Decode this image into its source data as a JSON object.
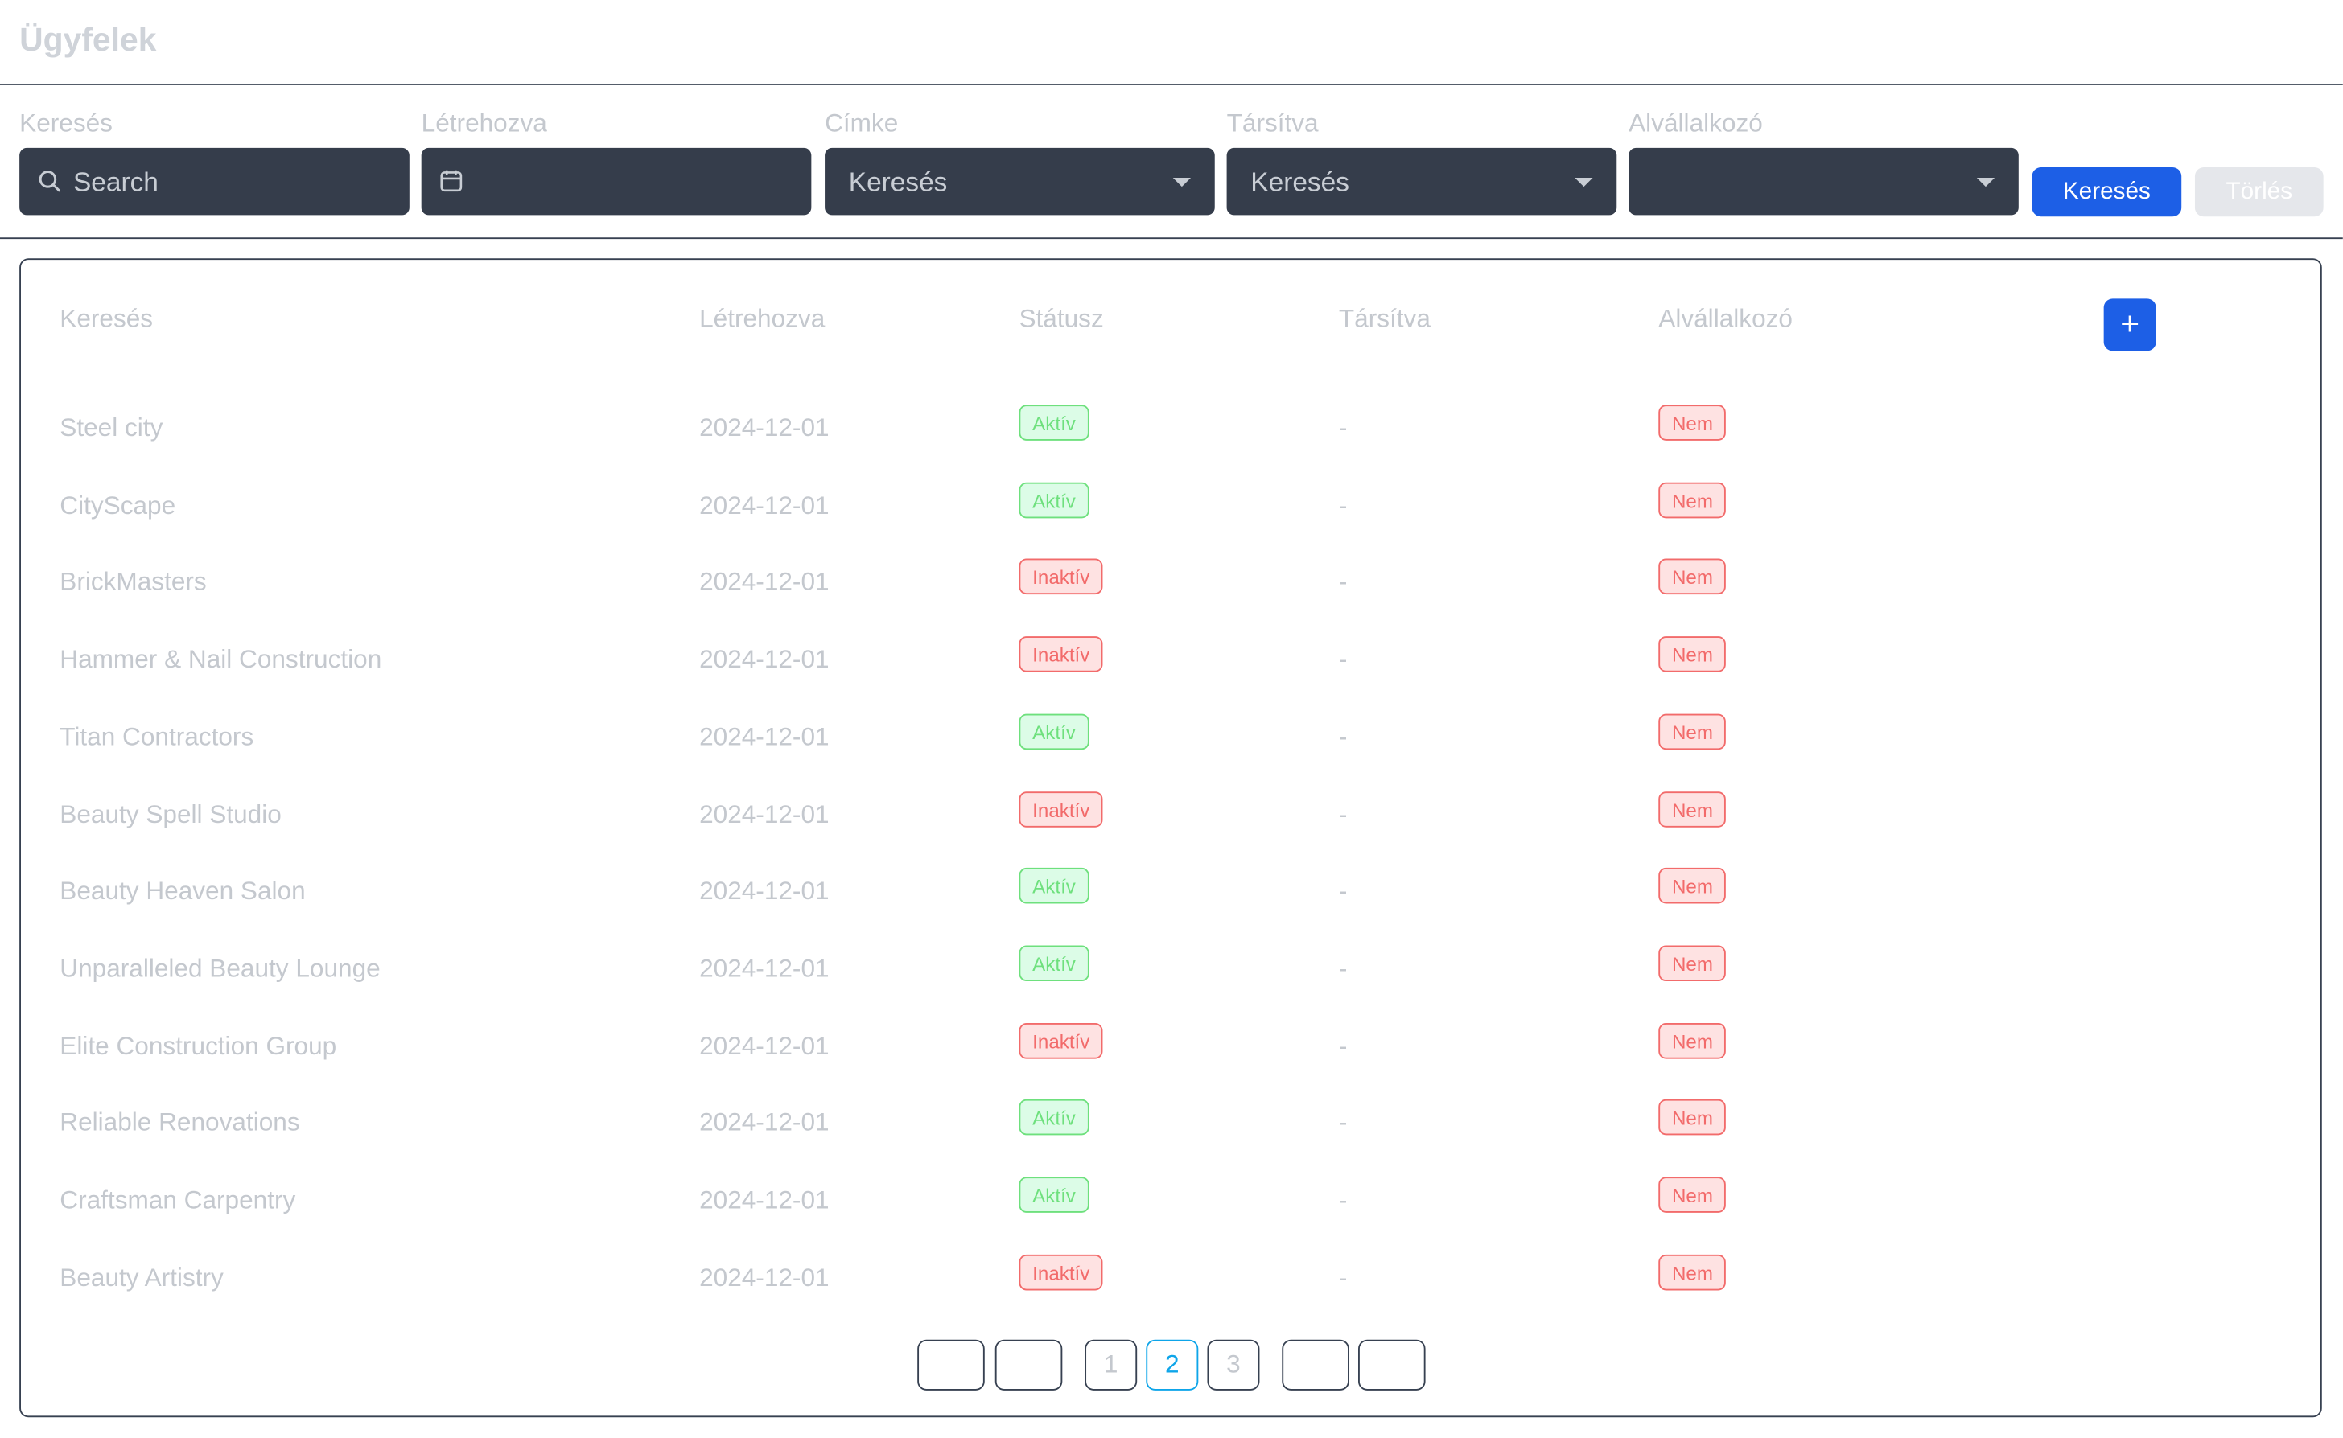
{
  "app": {
    "title": "Ügyfelek"
  },
  "filters": {
    "search": {
      "label": "Keresés",
      "placeholder": "Search"
    },
    "created": {
      "label": "Létrehozva",
      "value": ""
    },
    "tag": {
      "label": "Címke",
      "value": "Keresés"
    },
    "associated": {
      "label": "Társítva",
      "value": "Keresés"
    },
    "subcontractor": {
      "label": "Alvállalkozó",
      "value": ""
    },
    "search_button": "Keresés",
    "clear_button": "Törlés"
  },
  "table": {
    "headers": [
      "Keresés",
      "Létrehozva",
      "Státusz",
      "Társítva",
      "Alvállalkozó"
    ],
    "add_button": "+",
    "rows": [
      {
        "name": "Steel city",
        "created": "2024-12-01",
        "status": "Aktív",
        "status_type": "green",
        "associated": "-",
        "sub": "Nem"
      },
      {
        "name": "CityScape",
        "created": "2024-12-01",
        "status": "Aktív",
        "status_type": "green",
        "associated": "-",
        "sub": "Nem"
      },
      {
        "name": "BrickMasters",
        "created": "2024-12-01",
        "status": "Inaktív",
        "status_type": "red",
        "associated": "-",
        "sub": "Nem"
      },
      {
        "name": "Hammer & Nail Construction",
        "created": "2024-12-01",
        "status": "Inaktív",
        "status_type": "red",
        "associated": "-",
        "sub": "Nem"
      },
      {
        "name": "Titan Contractors",
        "created": "2024-12-01",
        "status": "Aktív",
        "status_type": "green",
        "associated": "-",
        "sub": "Nem"
      },
      {
        "name": "Beauty Spell Studio",
        "created": "2024-12-01",
        "status": "Inaktív",
        "status_type": "red",
        "associated": "-",
        "sub": "Nem"
      },
      {
        "name": "Beauty Heaven Salon",
        "created": "2024-12-01",
        "status": "Aktív",
        "status_type": "green",
        "associated": "-",
        "sub": "Nem"
      },
      {
        "name": "Unparalleled Beauty Lounge",
        "created": "2024-12-01",
        "status": "Aktív",
        "status_type": "green",
        "associated": "-",
        "sub": "Nem"
      },
      {
        "name": "Elite Construction Group",
        "created": "2024-12-01",
        "status": "Inaktív",
        "status_type": "red",
        "associated": "-",
        "sub": "Nem"
      },
      {
        "name": "Reliable Renovations",
        "created": "2024-12-01",
        "status": "Aktív",
        "status_type": "green",
        "associated": "-",
        "sub": "Nem"
      },
      {
        "name": "Craftsman Carpentry",
        "created": "2024-12-01",
        "status": "Aktív",
        "status_type": "green",
        "associated": "-",
        "sub": "Nem"
      },
      {
        "name": "Beauty Artistry",
        "created": "2024-12-01",
        "status": "Inaktív",
        "status_type": "red",
        "associated": "-",
        "sub": "Nem"
      }
    ]
  },
  "pagination": {
    "first": "",
    "prev": "",
    "pages": [
      "1",
      "2",
      "3"
    ],
    "current": "2",
    "next": "",
    "last": ""
  },
  "colors": {
    "primary": "#1d5fe6",
    "input_bg": "#353d4b",
    "active_badge": "#6ee07d",
    "inactive_badge": "#f26b6b",
    "pager_active": "#0ea5e9"
  }
}
